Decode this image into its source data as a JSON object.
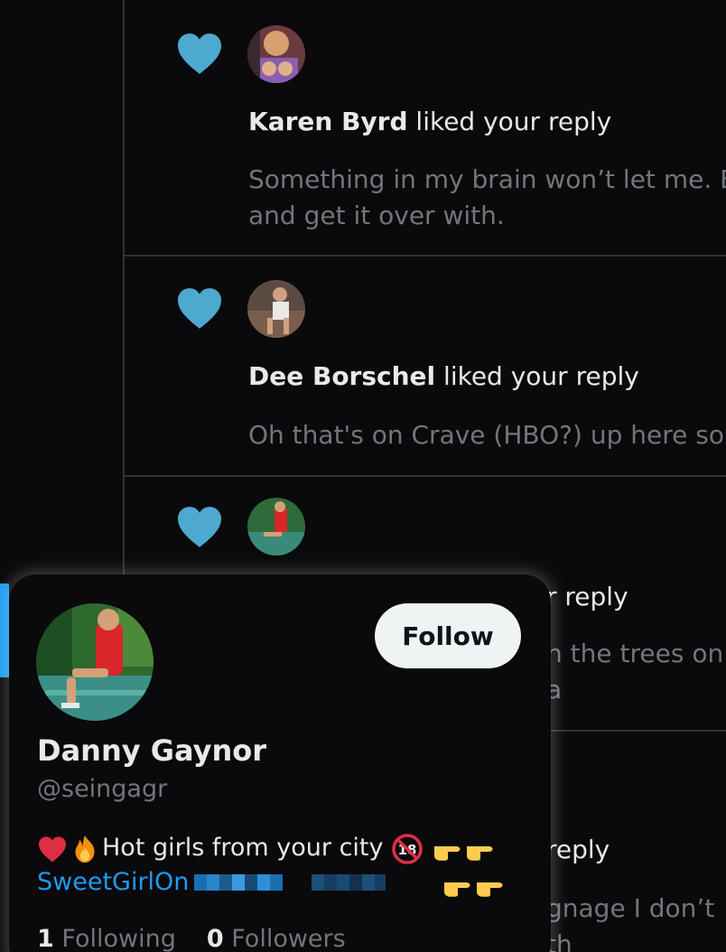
{
  "notifications": [
    {
      "user": "Karen Byrd",
      "action": " liked your reply",
      "reply_text": "Something in my brain won’t let me. Bu\nand get it over with."
    },
    {
      "user": "Dee Borschel",
      "action": " liked your reply",
      "reply_text": "Oh that's on Crave (HBO?) up here so I"
    },
    {
      "user": "",
      "action": "r reply",
      "reply_text": "h the trees on a"
    },
    {
      "user": "",
      "action": "reply",
      "reply_text": "gnage I don’t th"
    }
  ],
  "hover_card": {
    "name": "Danny Gaynor",
    "handle": "@seingagr",
    "follow_label": "Follow",
    "bio_text": "Hot girls from your city",
    "bio_link": "SweetGirlOn",
    "following_count": "1",
    "following_label": "Following",
    "followers_count": "0",
    "followers_label": "Followers"
  },
  "colors": {
    "heart": "#4ea9d0",
    "link": "#1d9bf0",
    "muted": "#71767b",
    "divider": "#2f3336"
  },
  "icons": [
    "heart-icon",
    "red-heart-emoji",
    "fire-emoji",
    "no-under-18-emoji",
    "pointing-right-emoji"
  ]
}
